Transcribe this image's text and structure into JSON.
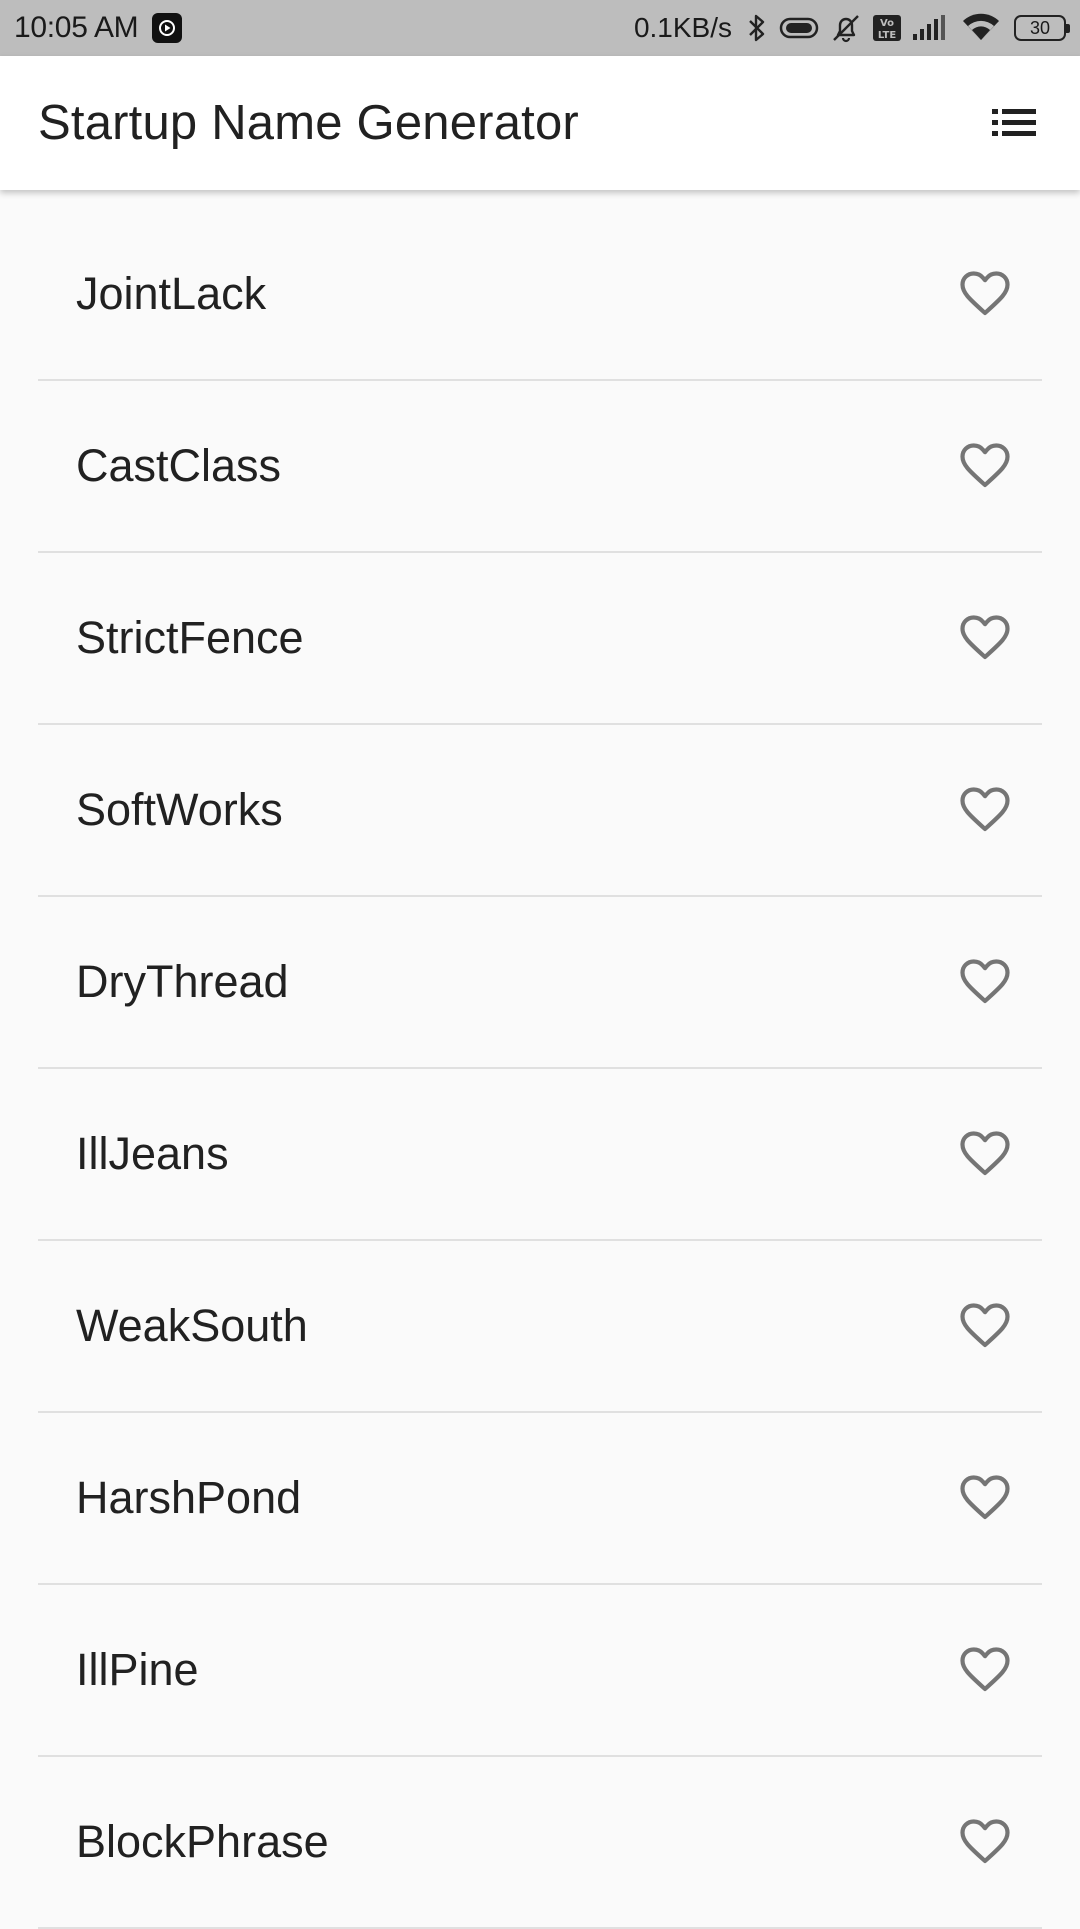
{
  "status_bar": {
    "time": "10:05 AM",
    "network_speed": "0.1KB/s",
    "battery_level": "30",
    "icons": [
      "media-app-icon",
      "bluetooth-icon",
      "vibrate-icon",
      "alarm-off-icon",
      "volte-icon",
      "signal-icon",
      "wifi-icon",
      "battery-icon"
    ]
  },
  "app_bar": {
    "title": "Startup Name Generator",
    "action_icon": "list-icon"
  },
  "word_pairs": [
    {
      "name": "JointLack",
      "favorited": false
    },
    {
      "name": "CastClass",
      "favorited": false
    },
    {
      "name": "StrictFence",
      "favorited": false
    },
    {
      "name": "SoftWorks",
      "favorited": false
    },
    {
      "name": "DryThread",
      "favorited": false
    },
    {
      "name": "IllJeans",
      "favorited": false
    },
    {
      "name": "WeakSouth",
      "favorited": false
    },
    {
      "name": "HarshPond",
      "favorited": false
    },
    {
      "name": "IllPine",
      "favorited": false
    },
    {
      "name": "BlockPhrase",
      "favorited": false
    }
  ],
  "colors": {
    "status_bar_bg": "#bdbdbd",
    "app_bar_bg": "#ffffff",
    "page_bg": "#fafafa",
    "divider": "#e0e0e0",
    "heart_outline": "#757575"
  }
}
